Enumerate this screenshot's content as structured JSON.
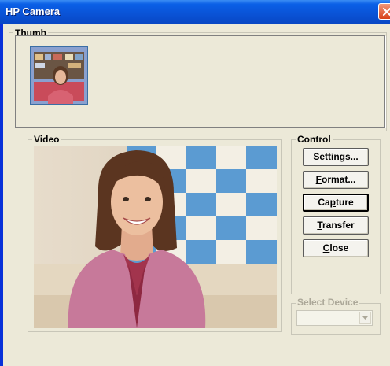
{
  "window": {
    "title": "HP Camera",
    "close_icon": "close-icon"
  },
  "thumb": {
    "label": "Thumb"
  },
  "video": {
    "label": "Video"
  },
  "control": {
    "label": "Control",
    "buttons": [
      {
        "pre": "",
        "key": "S",
        "post": "ettings..."
      },
      {
        "pre": "",
        "key": "F",
        "post": "ormat..."
      },
      {
        "pre": "Ca",
        "key": "p",
        "post": "ture"
      },
      {
        "pre": "",
        "key": "T",
        "post": "ransfer"
      },
      {
        "pre": "",
        "key": "C",
        "post": "lose"
      }
    ]
  },
  "device": {
    "label": "Select Device",
    "value": ""
  },
  "colors": {
    "title_bar": "#0a54d8",
    "dialog_bg": "#ece9d8",
    "close_button": "#d8431a"
  }
}
